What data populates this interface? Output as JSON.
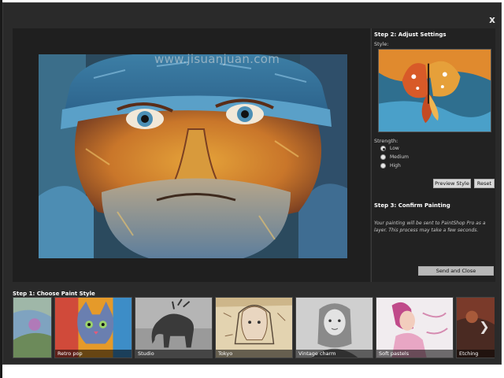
{
  "window": {
    "close_label": "x"
  },
  "preview": {
    "watermark": "www.jisuanjuan.com"
  },
  "step2": {
    "title": "Step 2: Adjust Settings",
    "style_label": "Style:",
    "strength_label": "Strength:",
    "strength_options": [
      {
        "label": "Low",
        "checked": true
      },
      {
        "label": "Medium",
        "checked": false
      },
      {
        "label": "High",
        "checked": false
      }
    ],
    "preview_style_button": "Preview Style",
    "reset_button": "Reset"
  },
  "step3": {
    "title": "Step 3: Confirm Painting",
    "description": "Your painting will be sent to PaintShop Pro as a layer. This process may take a few seconds.",
    "send_close_button": "Send and Close"
  },
  "step1": {
    "title": "Step 1: Choose Paint Style",
    "styles": [
      {
        "label": ""
      },
      {
        "label": "Retro pop"
      },
      {
        "label": "Studio"
      },
      {
        "label": "Tokyo"
      },
      {
        "label": "Vintage charm"
      },
      {
        "label": "Soft pastels"
      },
      {
        "label": "Etching"
      }
    ]
  },
  "colors": {
    "background": "#2a2a2a",
    "panel": "#222222",
    "button": "#d9d9d9"
  }
}
